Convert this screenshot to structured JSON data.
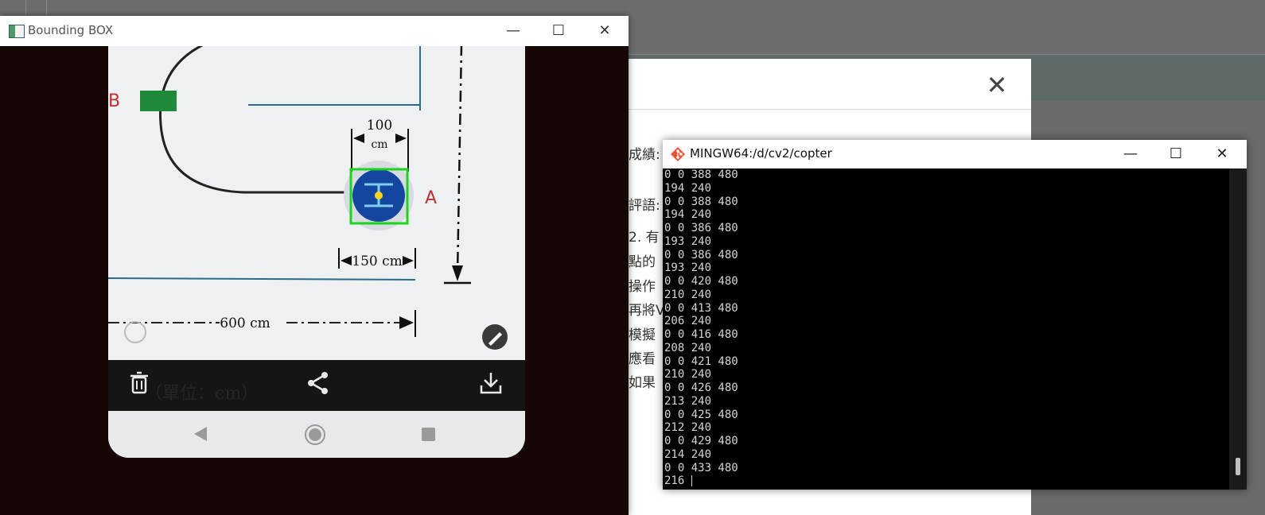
{
  "bounding_box_window": {
    "title": "Bounding BOX",
    "minimize": "—",
    "maximize": "☐",
    "close": "✕",
    "image": {
      "dimension_100": "100",
      "dimension_cm": "cm",
      "dimension_150": "150 cm",
      "dimension_600": "600 cm",
      "label_a": "A",
      "label_b": "B",
      "overlay_text": "（單位：cm）"
    }
  },
  "modal": {
    "close": "✕",
    "lines": [
      "成績:",
      "評語:",
      "2. 有",
      "點的",
      "操作",
      "再將V",
      "模擬",
      "應看",
      "如果"
    ]
  },
  "terminal": {
    "title": "MINGW64:/d/cv2/copter",
    "minimize": "—",
    "maximize": "☐",
    "close": "✕",
    "lines": [
      "0 0 388 480",
      "194 240",
      "0 0 388 480",
      "194 240",
      "0 0 386 480",
      "193 240",
      "0 0 386 480",
      "193 240",
      "0 0 420 480",
      "210 240",
      "0 0 413 480",
      "206 240",
      "0 0 416 480",
      "208 240",
      "0 0 421 480",
      "210 240",
      "0 0 426 480",
      "213 240",
      "0 0 425 480",
      "212 240",
      "0 0 429 480",
      "214 240",
      "0 0 433 480",
      "216 "
    ]
  },
  "colors": {
    "bounding_box": "#1dd41d",
    "target_circle": "#1446a0",
    "center_dot": "#f7d320",
    "accent_green_block": "#1f8a3a",
    "label_red": "#c03030"
  }
}
